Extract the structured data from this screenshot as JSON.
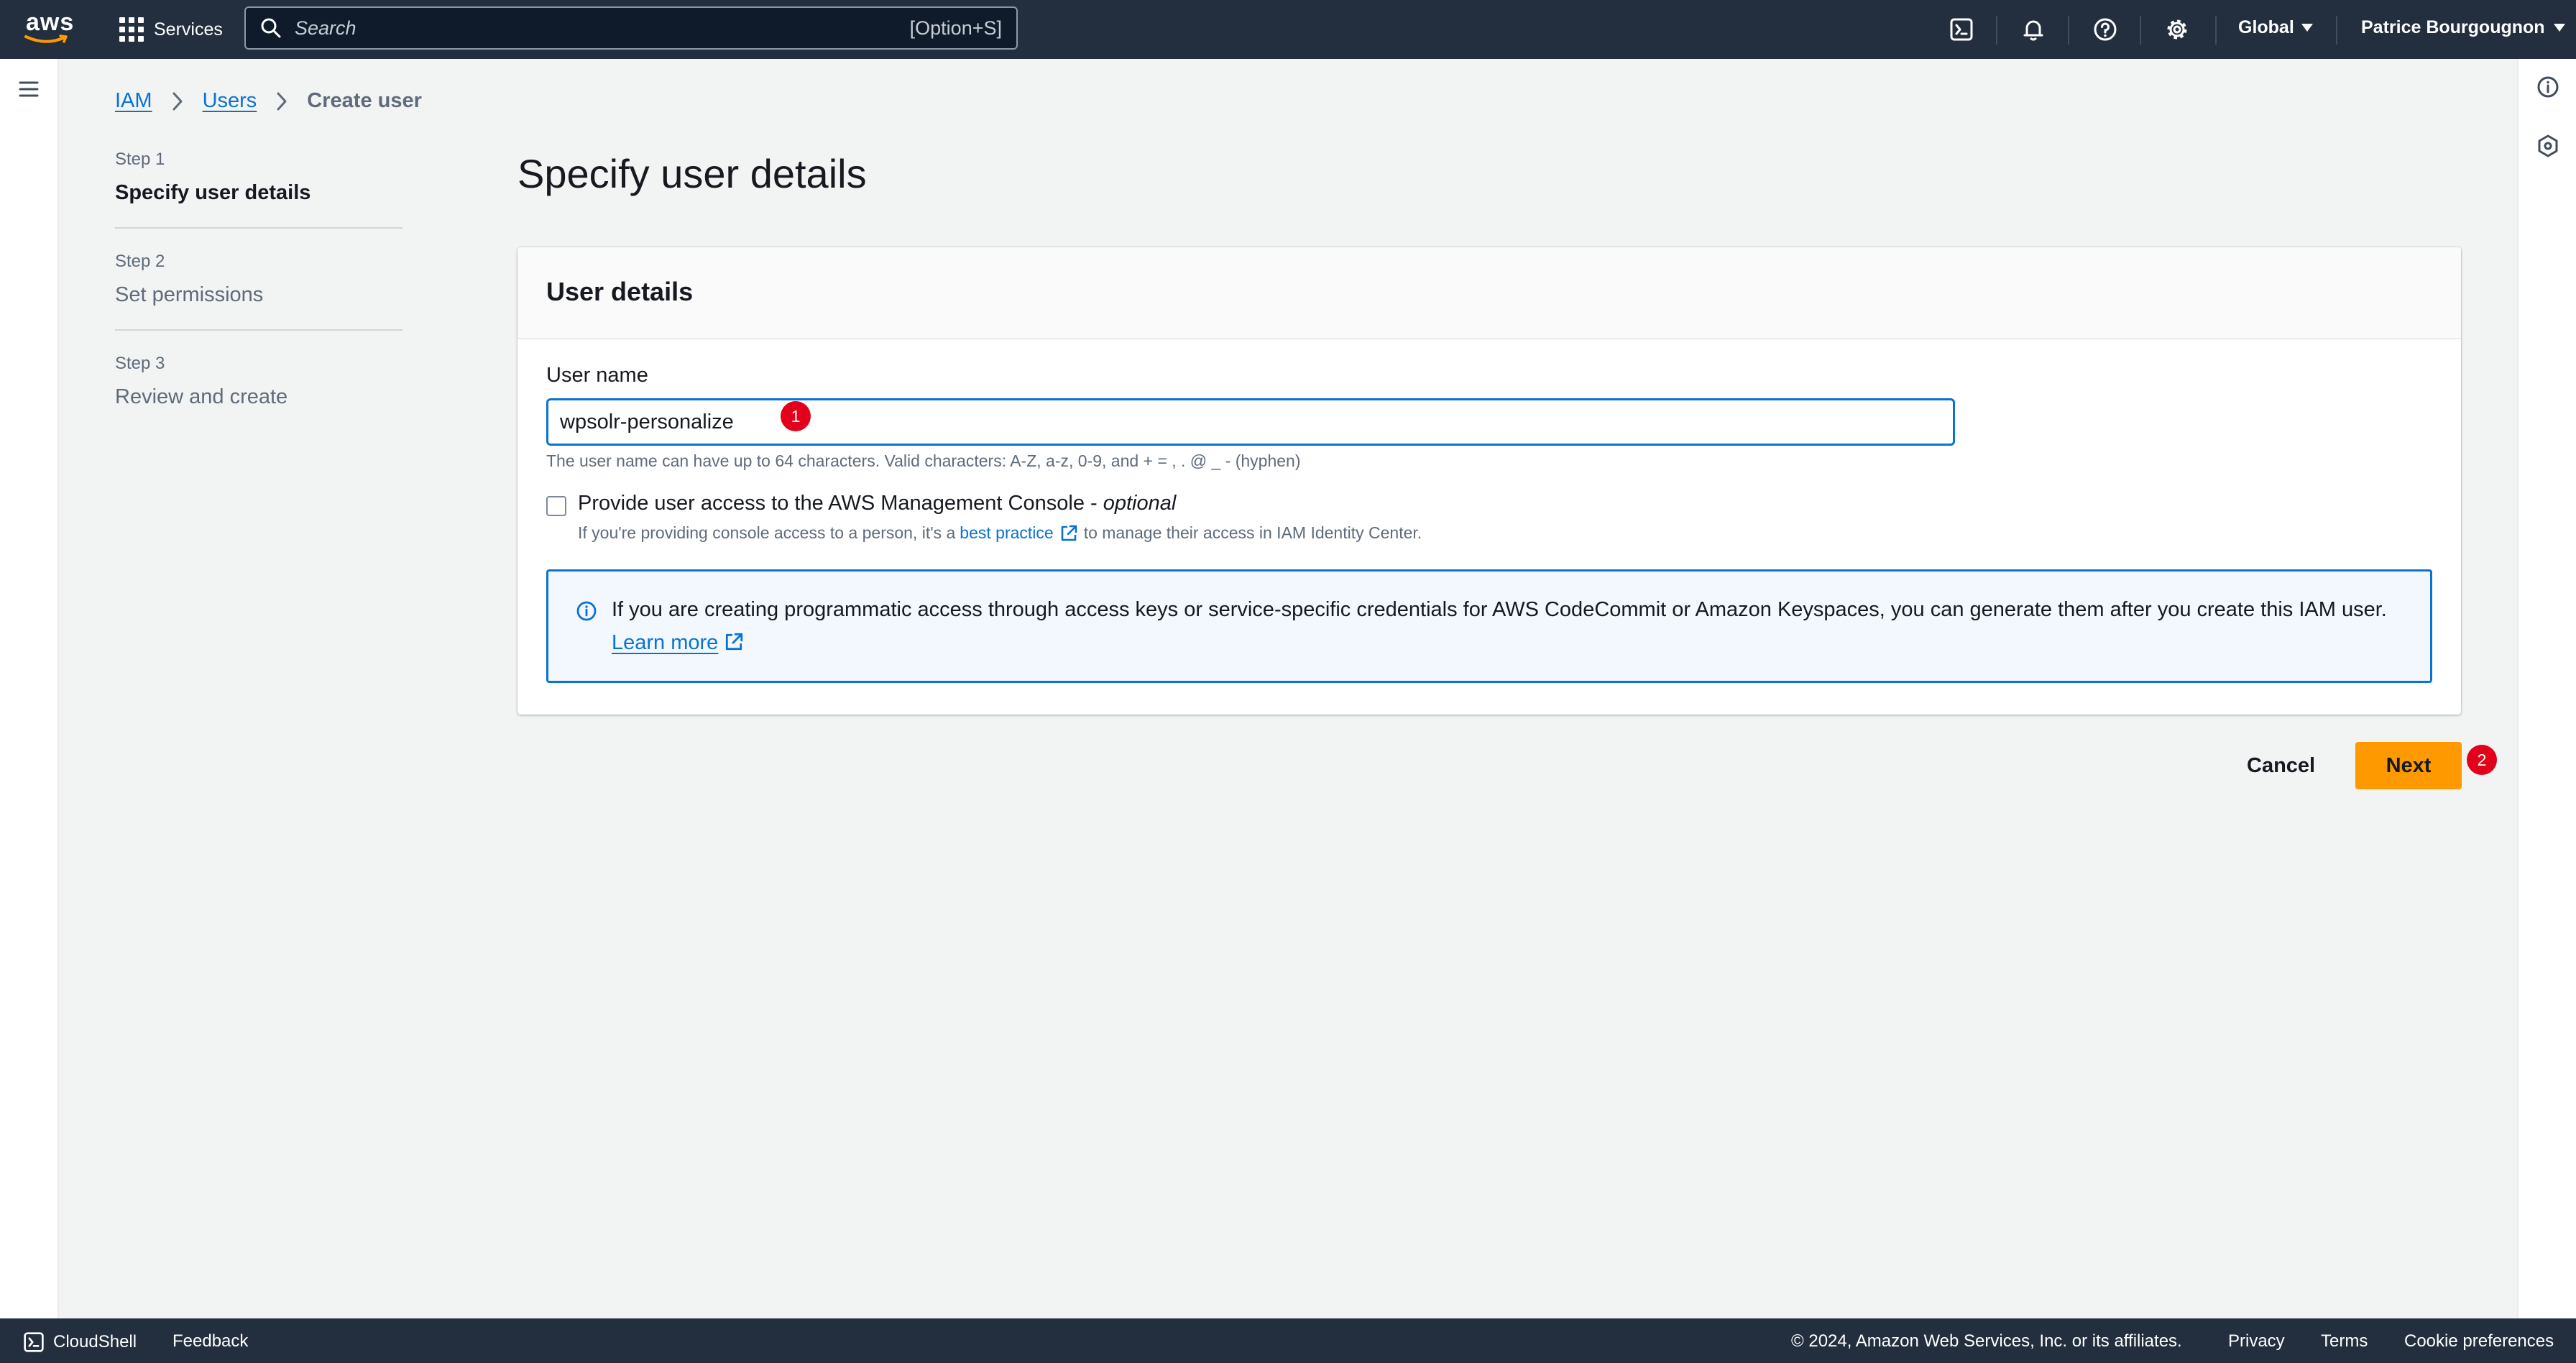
{
  "topnav": {
    "logo_text": "aws",
    "services_label": "Services",
    "search_placeholder": "Search",
    "search_shortcut": "[Option+S]",
    "icons": [
      "cloudshell-icon",
      "bell-icon",
      "help-icon",
      "settings-icon"
    ],
    "region_label": "Global",
    "account_label": "Patrice Bourgougnon"
  },
  "breadcrumb": {
    "items": [
      "IAM",
      "Users"
    ],
    "current": "Create user"
  },
  "steps": [
    {
      "number": "Step 1",
      "title": "Specify user details",
      "active": true
    },
    {
      "number": "Step 2",
      "title": "Set permissions",
      "active": false
    },
    {
      "number": "Step 3",
      "title": "Review and create",
      "active": false
    }
  ],
  "page_title": "Specify user details",
  "user_details": {
    "heading": "User details",
    "username_label": "User name",
    "username_value": "wpsolr-personalize",
    "username_hint": "The user name can have up to 64 characters. Valid characters: A-Z, a-z, 0-9, and + = , . @ _ - (hyphen)",
    "console_access_label": "Provide user access to the AWS Management Console - ",
    "console_access_optional": "optional",
    "console_access_checked": false,
    "console_desc_before": "If you're providing console access to a person, it's a",
    "console_desc_link": "best practice",
    "console_desc_after": "to manage their access in IAM Identity Center.",
    "info_text": "If you are creating programmatic access through access keys or service-specific credentials for AWS CodeCommit or Amazon Keyspaces, you can generate them after you create this IAM user. ",
    "info_link": "Learn more"
  },
  "actions": {
    "cancel_label": "Cancel",
    "next_label": "Next"
  },
  "annotations": [
    "1",
    "2"
  ],
  "footer": {
    "cloudshell_label": "CloudShell",
    "feedback_label": "Feedback",
    "copyright": "© 2024, Amazon Web Services, Inc. or its affiliates.",
    "links": [
      "Privacy",
      "Terms",
      "Cookie preferences"
    ]
  },
  "colors": {
    "nav_bg": "#232f3e",
    "link": "#0972d3",
    "primary_button": "#ff9900",
    "annotation_badge": "#e3001b",
    "page_bg": "#f2f3f3"
  }
}
